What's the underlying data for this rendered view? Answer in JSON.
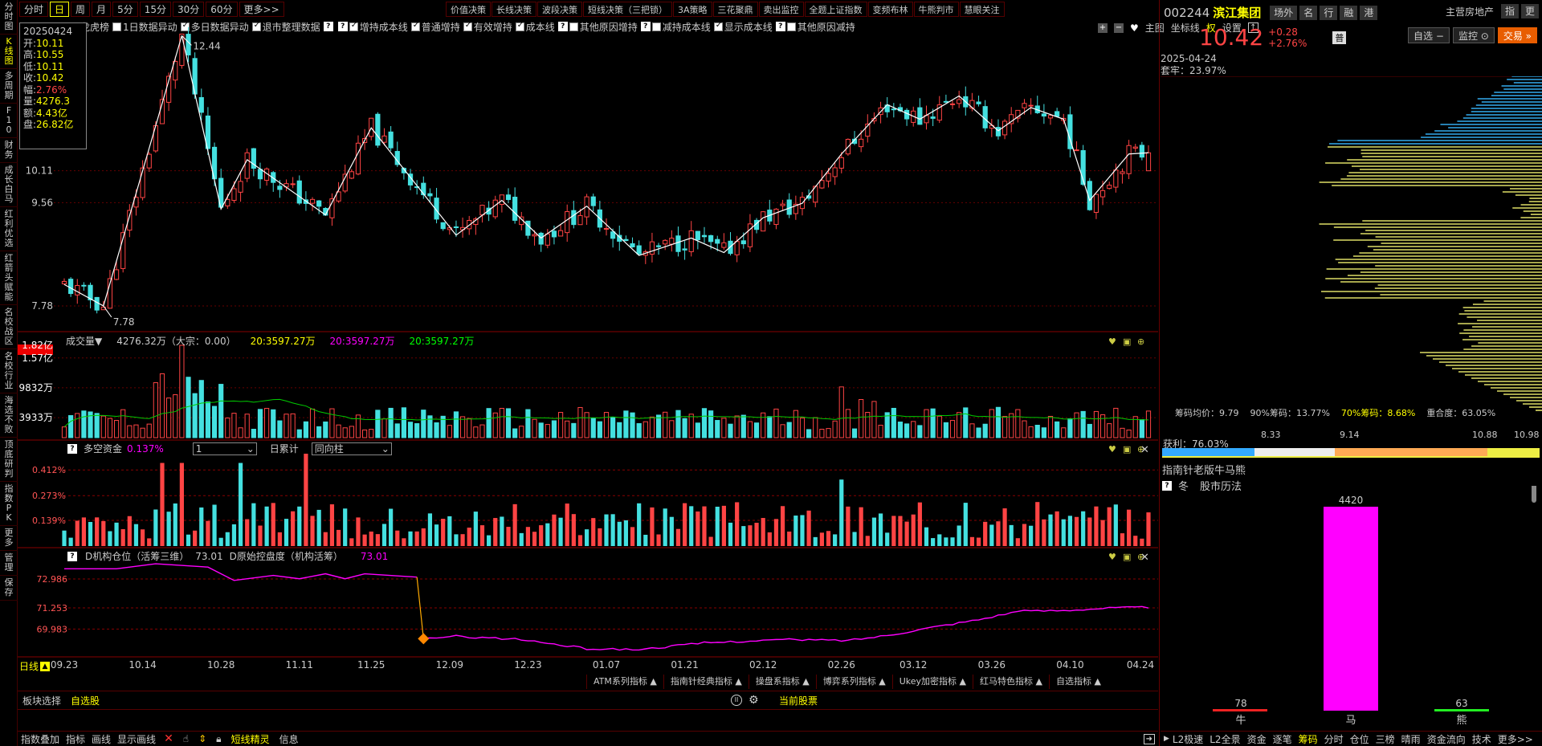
{
  "leftbar": [
    "分时图",
    "K线图",
    "多周期",
    "F10",
    "财务",
    "成长白马",
    "红利优选",
    "红箭头赋能",
    "名校战区",
    "名校行业",
    "海选不败",
    "顶底研判",
    "指数PK",
    "更多",
    "管理",
    "保存"
  ],
  "periods": [
    "分时",
    "日",
    "周",
    "月",
    "5分",
    "15分",
    "30分",
    "60分",
    "更多>>"
  ],
  "tools": [
    "价值决策",
    "长线决策",
    "波段决策",
    "短线决策（三把锁）",
    "3A策略",
    "三花聚鼎",
    "卖出监控",
    "全题上证指数",
    "变频布林",
    "牛熊判市",
    "慧眼关注"
  ],
  "options": [
    {
      "label": "龙虎榜",
      "cb": false,
      "q": false
    },
    {
      "label": "1日数据异动",
      "cb": true,
      "on": false
    },
    {
      "label": "多日数据异动",
      "cb": true,
      "on": true
    },
    {
      "label": "退市整理数据",
      "cb": true,
      "on": true
    },
    {
      "label": "",
      "q": true
    },
    {
      "label": "增持成本线",
      "q": true,
      "cb": true,
      "on": true
    },
    {
      "label": "普通增持",
      "cb": true,
      "on": true
    },
    {
      "label": "有效增持",
      "cb": true,
      "on": true
    },
    {
      "label": "成本线",
      "cb": true,
      "on": true
    },
    {
      "label": "其他原因增持",
      "q": true,
      "cb": true,
      "on": false
    },
    {
      "label": "减持成本线",
      "q": true,
      "cb": true,
      "on": false
    },
    {
      "label": "显示成本线",
      "cb": true,
      "on": true
    },
    {
      "label": "其他原因减持",
      "q": true,
      "cb": true,
      "on": false
    }
  ],
  "opt_right": {
    "main": "主图",
    "coord": "坐标线",
    "right": "权",
    "settings": "设置"
  },
  "info": {
    "date": "20250424",
    "open_l": "开:",
    "open": "10.11",
    "high_l": "高:",
    "high": "10.55",
    "low_l": "低:",
    "low": "10.11",
    "close_l": "收:",
    "close": "10.42",
    "range_l": "幅:",
    "range": "2.76%",
    "vol_l": "量:",
    "vol": "4276.3",
    "amt_l": "额:",
    "amt": "4.43亿",
    "pan_l": "盘:",
    "pan": "26.82亿"
  },
  "main_chart": {
    "high_label": "12.44",
    "low_label": "7.78",
    "yticks": [
      "10.11",
      "9.56",
      "7.78"
    ]
  },
  "vol_panel": {
    "title": "成交量▼",
    "value": "4276.32万（大宗：0.00）",
    "ma1": "20:3597.27万",
    "ma2": "20:3597.27万",
    "ma3": "20:3597.27万",
    "yticks": [
      "1.82亿",
      "1.57亿",
      "9832万",
      "3933万"
    ]
  },
  "dk_panel": {
    "title": "多空资金",
    "value": "0.137%",
    "sel1": "1",
    "sel2": "日累计",
    "sel3": "同向柱",
    "yticks": [
      "0.412%",
      "0.273%",
      "0.139%"
    ]
  },
  "inst_panel": {
    "title": "D机构仓位（活筹三维）",
    "val": "73.01",
    "title2": "D原始控盘度（机构活筹）",
    "val2": "73.01",
    "yticks": [
      "72.986",
      "71.253",
      "69.983"
    ]
  },
  "xaxis": {
    "label": "日线",
    "dates": [
      "09.23",
      "10.14",
      "10.28",
      "11.11",
      "11.25",
      "12.09",
      "12.23",
      "01.07",
      "01.21",
      "02.12",
      "02.26",
      "03.12",
      "03.26",
      "04.10",
      "04.24"
    ]
  },
  "indicator_tabs": [
    "ATM系列指标",
    "指南针经典指标",
    "操盘系指标",
    "博弈系列指标",
    "Ukey加密指标",
    "红马特色指标",
    "自选指标"
  ],
  "block": {
    "label": "板块选择",
    "value": "自选股",
    "current": "当前股票"
  },
  "bottom": [
    "指数叠加",
    "指标",
    "画线",
    "显示画线"
  ],
  "bottom2": [
    "短线精灵",
    "信息"
  ],
  "stock": {
    "code": "002244",
    "name": "滨江集团",
    "tabs": [
      "场外",
      "名",
      "行",
      "融",
      "港"
    ],
    "industry": "主营房地产",
    "itabs": [
      "指",
      "更"
    ],
    "price": "10.42",
    "chg": "+0.28",
    "pct": "+2.76%",
    "tag": "普",
    "btn1": "自选",
    "btn2": "监控",
    "btn3": "交易"
  },
  "chip": {
    "date": "2025-04-24",
    "trap": "套牢：23.97%",
    "avg": "筹码均价：9.79",
    "p90": "90%筹码：13.77%",
    "p70": "70%筹码：8.68%",
    "overlap": "重合度：63.05%",
    "profit": "获利：76.03%",
    "s1": "8.33",
    "s2": "9.14",
    "s3": "10.88",
    "s4": "10.98"
  },
  "bull": {
    "title": "指南针老版牛马熊",
    "season": "冬",
    "law": "股市历法",
    "bull": "78",
    "horse": "4420",
    "bear": "63",
    "bull_l": "牛",
    "horse_l": "马",
    "bear_l": "熊"
  },
  "rbot": [
    "L2极速",
    "L2全景",
    "资金",
    "逐笔",
    "筹码",
    "分时",
    "仓位",
    "三榜",
    "晴雨",
    "资金流向",
    "技术",
    "更多>>"
  ],
  "colors": {
    "up": "#ff4444",
    "down": "#44e0e0",
    "bg": "#000",
    "yellow": "#ffff00",
    "magenta": "#ff00ff"
  }
}
